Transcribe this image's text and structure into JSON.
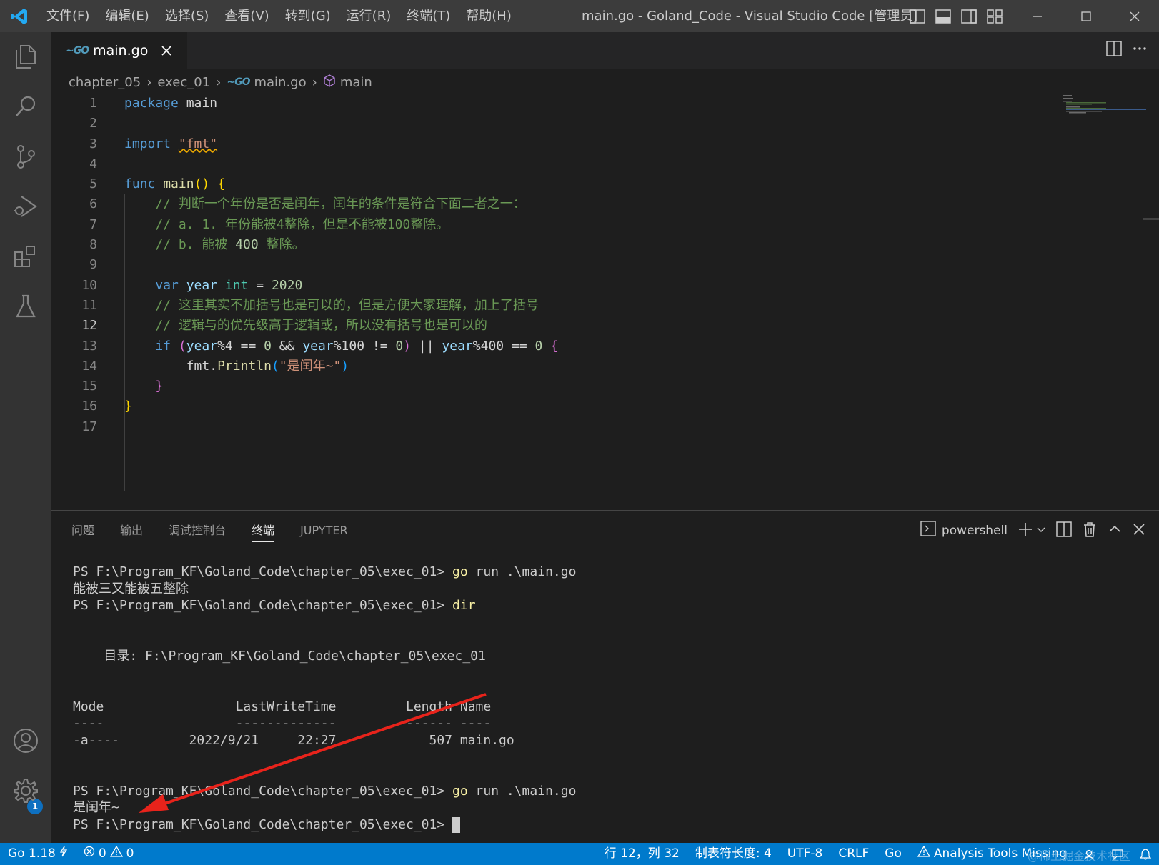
{
  "titlebar": {
    "menus": [
      "文件(F)",
      "编辑(E)",
      "选择(S)",
      "查看(V)",
      "转到(G)",
      "运行(R)",
      "终端(T)",
      "帮助(H)"
    ],
    "window_title": "main.go - Goland_Code - Visual Studio Code [管理员]"
  },
  "tabs": [
    {
      "label": "main.go",
      "language_icon": "go-icon"
    }
  ],
  "breadcrumb": [
    "chapter_05",
    "exec_01",
    "main.go",
    "main"
  ],
  "editor": {
    "active_line": 12,
    "line_numbers": [
      "1",
      "2",
      "3",
      "4",
      "5",
      "6",
      "7",
      "8",
      "9",
      "10",
      "11",
      "12",
      "13",
      "14",
      "15",
      "16",
      "17"
    ],
    "lines": [
      "package main",
      "",
      "import \"fmt\"",
      "",
      "func main() {",
      "    // 判断一个年份是否是闰年，闰年的条件是符合下面二者之一：",
      "    // a. 1. 年份能被4整除，但是不能被100整除。",
      "    // b. 能被 400 整除。",
      "",
      "    var year int = 2020",
      "    // 这里其实不加括号也是可以的，但是方便大家理解，加上了括号",
      "    // 逻辑与的优先级高于逻辑或，所以没有括号也是可以的",
      "    if (year%4 == 0 && year%100 != 0) || year%400 == 0 {",
      "        fmt.Println(\"是闰年~\")",
      "    }",
      "}",
      ""
    ],
    "tokens": {
      "package": "package",
      "main": "main",
      "import": "import",
      "fmt_str": "\"fmt\"",
      "func": "func",
      "main_fn": "main",
      "parens": "()",
      "lbrace": "{",
      "c6": "// 判断一个年份是否是闰年，闰年的条件是符合下面二者之一：",
      "c7a": "// a. 1. 年份能被4整除，但是不能被100整除。",
      "c8a": "// b. 能被 ",
      "c8num": "400",
      "c8b": " 整除。",
      "var": "var",
      "year": "year",
      "int": "int",
      "eq": " = ",
      "n2020": "2020",
      "c11": "// 这里其实不加括号也是可以的，但是方便大家理解，加上了括号",
      "c12": "// 逻辑与的优先级高于逻辑或，所以没有括号也是可以的",
      "if": "if",
      "lp": "(",
      "yr1": "year",
      "m4": "%4 == ",
      "z1": "0",
      "and": " && ",
      "yr2": "year",
      "m100": "%100 != ",
      "z2": "0",
      "rp": ")",
      "or": " || ",
      "yr3": "year",
      "m400": "%400 == ",
      "z3": "0",
      "lb13": "{",
      "fmt": "fmt",
      "dot": ".",
      "println": "Println",
      "lp14": "(",
      "s14": "\"是闰年~\"",
      "rp14": ")",
      "rb15": "}",
      "rb16": "}"
    }
  },
  "panel": {
    "tabs": [
      "问题",
      "输出",
      "调试控制台",
      "终端",
      "JUPYTER"
    ],
    "active_tab": "终端",
    "shell": "powershell",
    "terminal_lines": [
      {
        "prompt": "PS F:\\Program_KF\\Goland_Code\\chapter_05\\exec_01> ",
        "cmd": "go",
        "rest": " run .\\main.go"
      },
      {
        "text": "能被三又能被五整除"
      },
      {
        "prompt": "PS F:\\Program_KF\\Goland_Code\\chapter_05\\exec_01> ",
        "cmd": "dir",
        "rest": ""
      },
      {
        "text": ""
      },
      {
        "text": ""
      },
      {
        "text": "    目录: F:\\Program_KF\\Goland_Code\\chapter_05\\exec_01"
      },
      {
        "text": ""
      },
      {
        "text": ""
      },
      {
        "text": "Mode                 LastWriteTime         Length Name"
      },
      {
        "text": "----                 -------------         ------ ----"
      },
      {
        "text": "-a----         2022/9/21     22:27            507 main.go"
      },
      {
        "text": ""
      },
      {
        "text": ""
      },
      {
        "prompt": "PS F:\\Program_KF\\Goland_Code\\chapter_05\\exec_01> ",
        "cmd": "go",
        "rest": " run .\\main.go"
      },
      {
        "text": "是闰年~"
      },
      {
        "prompt": "PS F:\\Program_KF\\Goland_Code\\chapter_05\\exec_01> ",
        "cmd": "",
        "rest": "",
        "cursor": true
      }
    ]
  },
  "activity": {
    "accounts_badge": "1"
  },
  "statusbar": {
    "go_version": "Go 1.18",
    "errors": "0",
    "warnings": "0",
    "position": "行 12，列 32",
    "tab_size": "制表符长度: 4",
    "encoding": "UTF-8",
    "eol": "CRLF",
    "language": "Go",
    "analysis": "Analysis Tools Missing",
    "watermark": "@稀土掘金技术社区"
  },
  "colors": {
    "accent": "#007acc",
    "annotation_arrow": "#e8231b"
  }
}
